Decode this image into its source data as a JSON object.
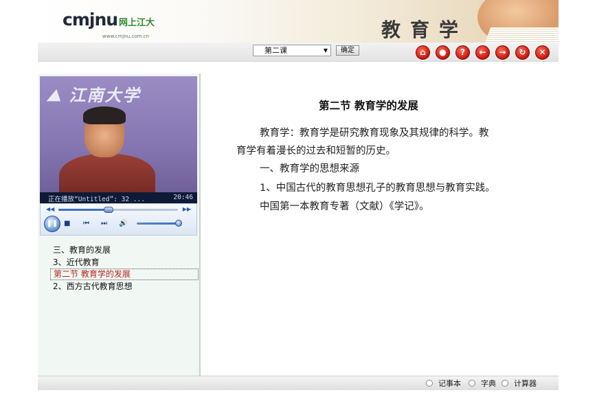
{
  "header": {
    "logo_text": "cmjnu",
    "logo_cn": "网上江大",
    "logo_url": "www.cmjnu.com.cn",
    "course_title": "教育学"
  },
  "toolbar": {
    "lesson_selected": "第二课",
    "confirm_label": "确定",
    "nav_buttons": [
      {
        "name": "home-icon",
        "glyph": "⌂"
      },
      {
        "name": "user-icon",
        "glyph": "●"
      },
      {
        "name": "help-icon",
        "glyph": "?"
      },
      {
        "name": "back-icon",
        "glyph": "←"
      },
      {
        "name": "forward-icon",
        "glyph": "→"
      },
      {
        "name": "refresh-icon",
        "glyph": "↻"
      },
      {
        "name": "close-icon",
        "glyph": "✕"
      }
    ]
  },
  "player": {
    "now_playing": "正在播放“Untitled”: 32 ...",
    "time": "20:46",
    "seek_fraction": 0.42,
    "volume_fraction": 0.95
  },
  "chapters": [
    {
      "label": "三、教育的发展",
      "active": false
    },
    {
      "label": "3、近代教育",
      "active": false
    },
    {
      "label": "第二节  教育学的发展",
      "active": true
    },
    {
      "label": "2、西方古代教育思想",
      "active": false
    }
  ],
  "content": {
    "section_title": "第二节   教育学的发展",
    "paragraphs": [
      "教育学：教育学是研究教育现象及其规律的科学。教",
      "育学有着漫长的过去和短暂的历史。",
      "一、教育学的思想来源",
      "1、中国古代的教育思想孔子的教育思想与教育实践。",
      "中国第一本教育专著（文献）《学记》。"
    ]
  },
  "footer": {
    "notepad": "记事本",
    "dictionary": "字典",
    "calculator": "计算器"
  },
  "colors": {
    "accent_red": "#c8160a",
    "active_chapter": "#b8241c",
    "panel_bg": "#f1f7f2"
  }
}
